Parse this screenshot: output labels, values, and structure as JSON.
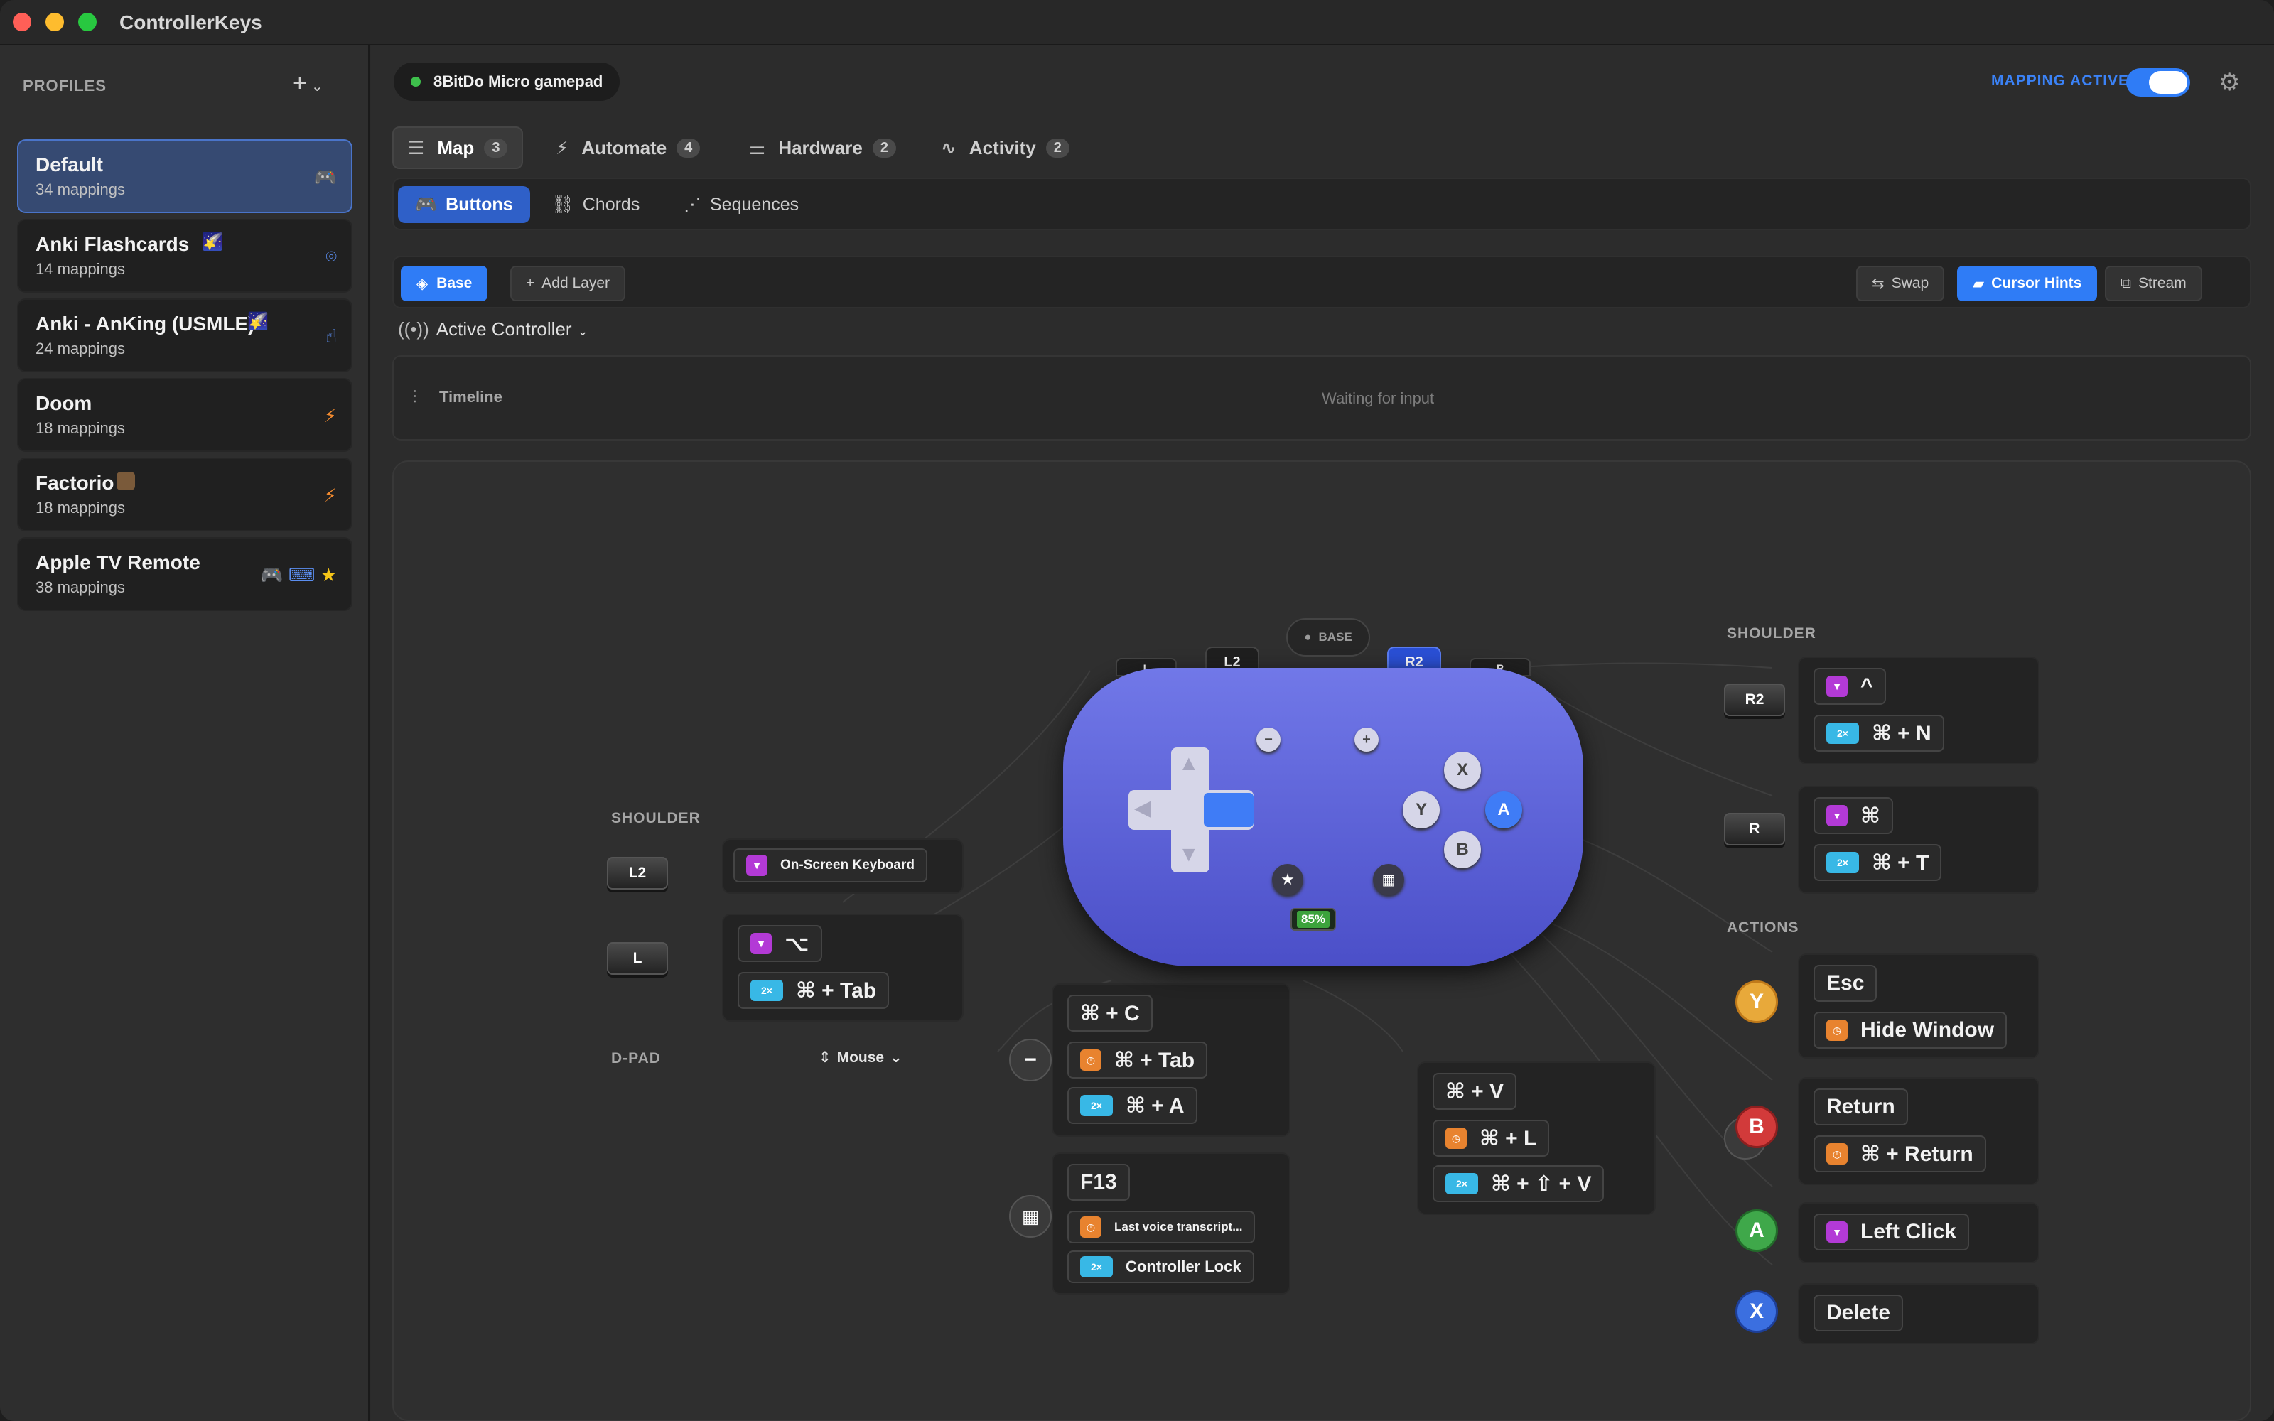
{
  "app": {
    "title": "ControllerKeys"
  },
  "sidebar": {
    "header": "PROFILES",
    "add_label": "+",
    "profiles": [
      {
        "name": "Default",
        "count": "34 mappings"
      },
      {
        "name": "Anki Flashcards",
        "count": "14 mappings"
      },
      {
        "name": "Anki - AnKing (USMLE)",
        "count": "24 mappings"
      },
      {
        "name": "Doom",
        "count": "18 mappings"
      },
      {
        "name": "Factorio",
        "count": "18 mappings"
      },
      {
        "name": "Apple TV Remote",
        "count": "38 mappings"
      }
    ]
  },
  "header": {
    "device": "8BitDo Micro gamepad",
    "mapping_active": "MAPPING ACTIVE"
  },
  "tabs": [
    {
      "label": "Map",
      "count": "3"
    },
    {
      "label": "Automate",
      "count": "4"
    },
    {
      "label": "Hardware",
      "count": "2"
    },
    {
      "label": "Activity",
      "count": "2"
    }
  ],
  "subtabs": [
    "Buttons",
    "Chords",
    "Sequences"
  ],
  "layers": {
    "base": "Base",
    "add": "Add Layer",
    "swap": "Swap",
    "cursor_hints": "Cursor Hints",
    "stream": "Stream"
  },
  "controller_select": "Active Controller",
  "timeline": {
    "label": "Timeline",
    "status": "Waiting for input"
  },
  "canvas": {
    "left_shoulder_title": "SHOULDER",
    "dpad_title": "D-PAD",
    "dpad_mode": "Mouse",
    "right_shoulder_title": "SHOULDER",
    "actions_title": "ACTIONS",
    "layer_badge": "BASE",
    "battery": "85%",
    "keys": {
      "l2": "L2",
      "l": "L",
      "r2": "R2",
      "r": "R"
    },
    "face": {
      "x": "X",
      "y": "Y",
      "a": "A",
      "b": "B",
      "minus": "−",
      "plus": "+"
    },
    "l2_card": {
      "c1": "On-Screen Keyboard"
    },
    "l_card": {
      "c1": "⌥",
      "c2": "⌘ + Tab"
    },
    "minus_card": {
      "c1": "⌘ + C",
      "c2": "⌘ + Tab",
      "c3": "⌘ + A"
    },
    "home_card": {
      "c1": "F13",
      "c2": "Last voice transcript...",
      "c3": "Controller Lock"
    },
    "plus_card": {
      "c1": "⌘ + V",
      "c2": "⌘ + L",
      "c3": "⌘ + ⇧ + V"
    },
    "r2_card": {
      "c1": "^",
      "c2": "⌘ + N"
    },
    "r_card": {
      "c1": "⌘",
      "c2": "⌘ + T"
    },
    "y_card": {
      "c1": "Esc",
      "c2": "Hide Window"
    },
    "b_card": {
      "c1": "Return",
      "c2": "⌘ + Return"
    },
    "a_card": {
      "c1": "Left Click"
    },
    "x_card": {
      "c1": "Delete"
    },
    "tap2": "2×"
  }
}
